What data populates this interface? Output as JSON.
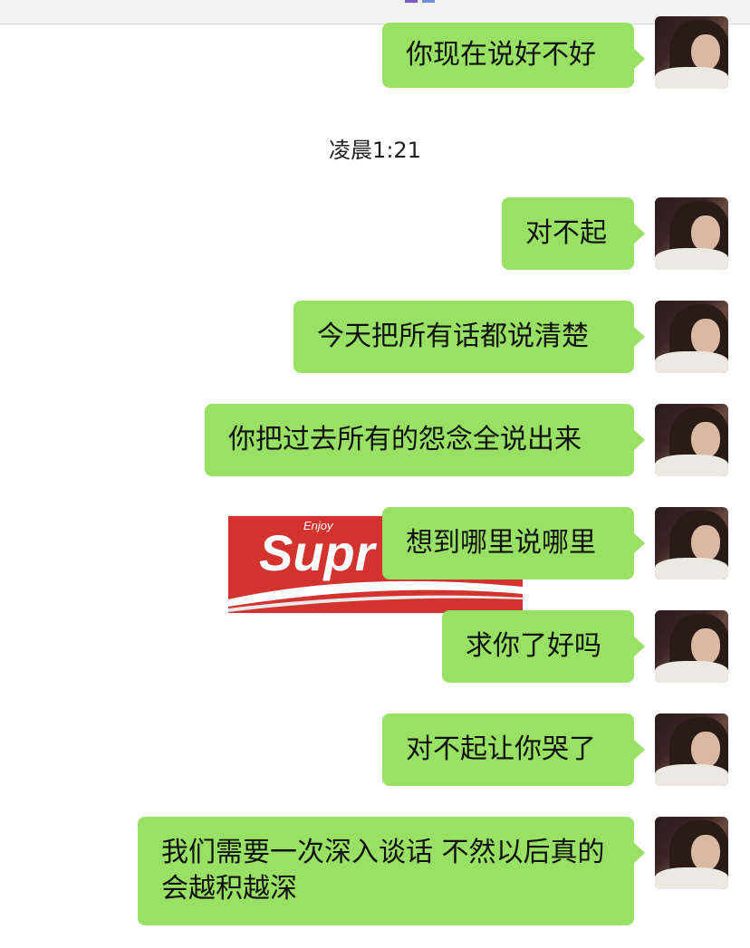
{
  "chat": {
    "timestamp": "凌晨1:21",
    "messages": [
      {
        "text": "你现在说好不好"
      },
      {
        "text": "对不起"
      },
      {
        "text": "今天把所有话都说清楚"
      },
      {
        "text": "你把过去所有的怨念全说出来"
      },
      {
        "text": "想到哪里说哪里"
      },
      {
        "text": "求你了好吗"
      },
      {
        "text": "对不起让你哭了"
      },
      {
        "text": "我们需要一次深入谈话 不然以后真的会越积越深"
      }
    ],
    "sticker": {
      "small_text": "Enjoy",
      "main_text": "Supr"
    }
  },
  "colors": {
    "bubble": "#98e165",
    "sticker_red": "#d2332f"
  }
}
